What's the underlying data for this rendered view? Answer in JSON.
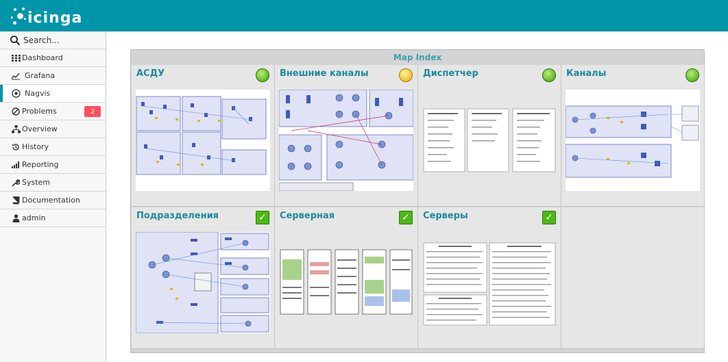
{
  "header": {
    "brand": "icinga"
  },
  "sidebar": {
    "search_placeholder": "Search...",
    "items": [
      {
        "label": "Dashboard",
        "icon": "dashboard-icon"
      },
      {
        "label": "Grafana",
        "icon": "grafana-icon"
      },
      {
        "label": "Nagvis",
        "icon": "nagvis-icon",
        "active": true
      },
      {
        "label": "Problems",
        "icon": "problems-icon",
        "badge": "2"
      },
      {
        "label": "Overview",
        "icon": "overview-icon"
      },
      {
        "label": "History",
        "icon": "history-icon"
      },
      {
        "label": "Reporting",
        "icon": "reporting-icon"
      },
      {
        "label": "System",
        "icon": "wrench-icon"
      },
      {
        "label": "Documentation",
        "icon": "book-icon"
      },
      {
        "label": "admin",
        "icon": "user-icon"
      }
    ]
  },
  "map_index": {
    "title": "Map Index",
    "maps": [
      {
        "name": "АСДУ",
        "state": "circle-green"
      },
      {
        "name": "Внешние каналы",
        "state": "circle-yellow"
      },
      {
        "name": "Диспетчер",
        "state": "circle-green"
      },
      {
        "name": "Каналы",
        "state": "circle-green"
      },
      {
        "name": "Подразделения",
        "state": "ok"
      },
      {
        "name": "Серверная",
        "state": "ok"
      },
      {
        "name": "Серверы",
        "state": "ok"
      }
    ]
  },
  "colors": {
    "accent": "#0095a8",
    "title": "#1a8aa0",
    "badge": "#ff4d5e"
  }
}
